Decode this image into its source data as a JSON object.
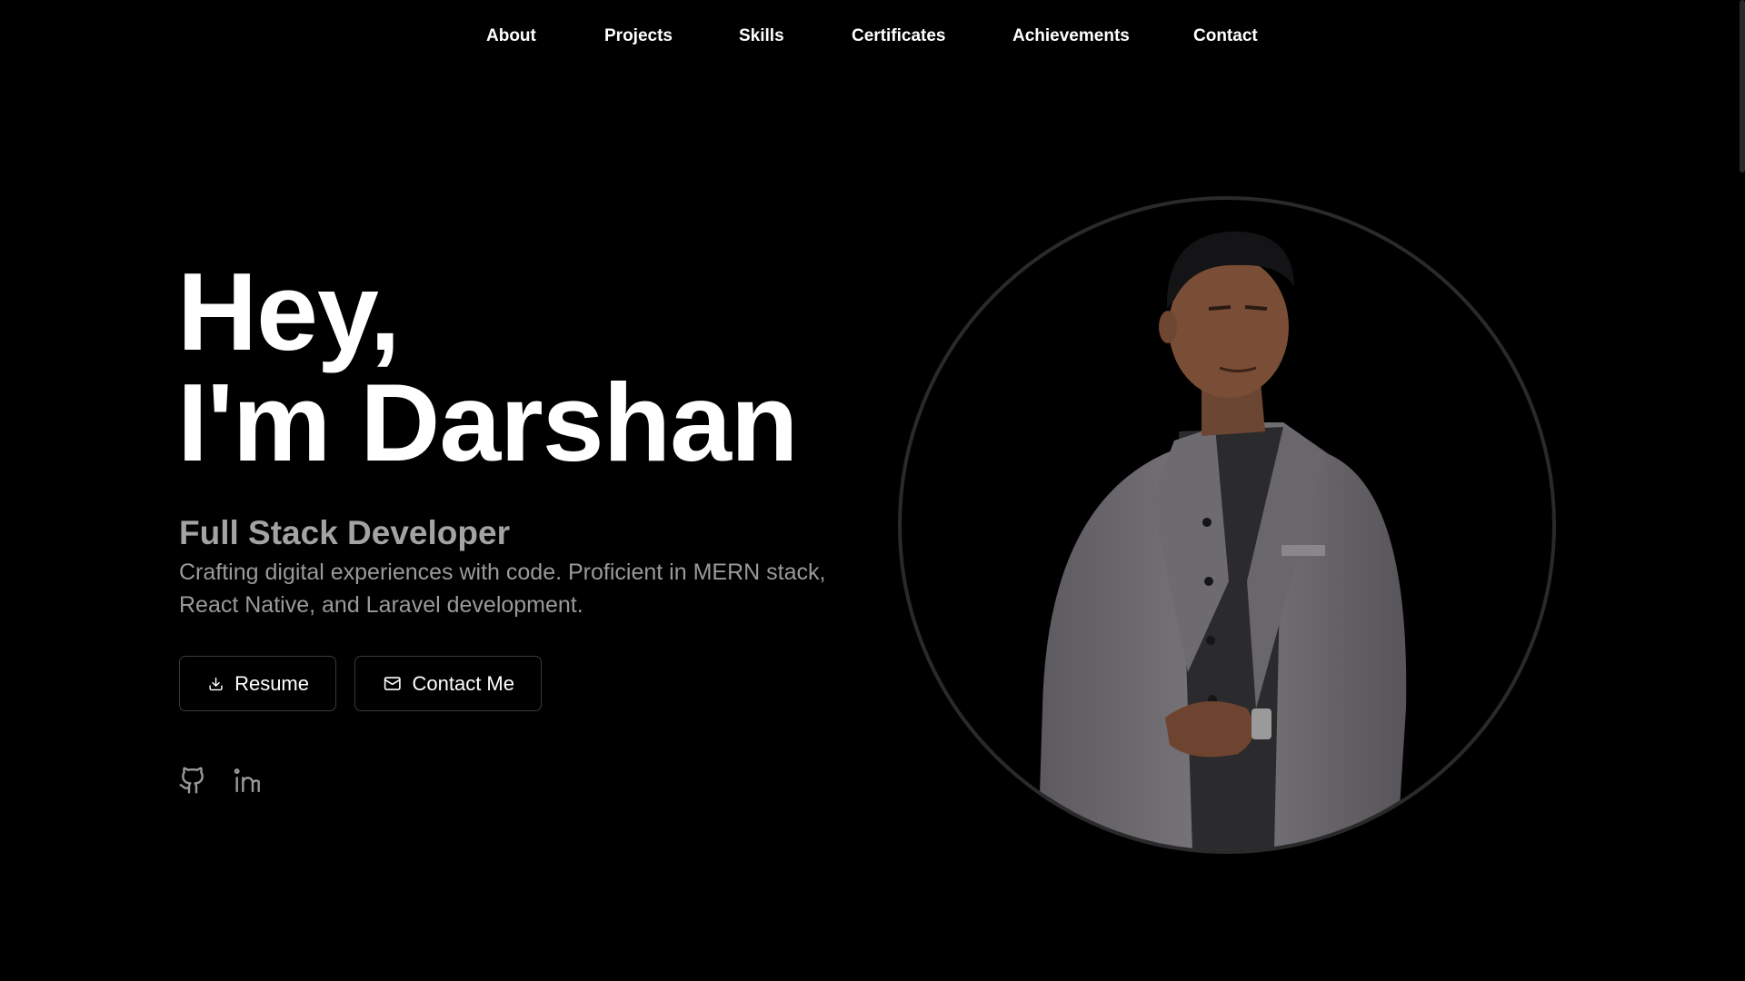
{
  "nav": {
    "items": [
      {
        "label": "About"
      },
      {
        "label": "Projects"
      },
      {
        "label": "Skills"
      },
      {
        "label": "Certificates"
      },
      {
        "label": "Achievements"
      },
      {
        "label": "Contact"
      }
    ]
  },
  "hero": {
    "greeting": "Hey,",
    "name_line": "I'm Darshan",
    "role": "Full Stack Developer",
    "description": "Crafting digital experiences with code. Proficient in MERN stack, React Native, and Laravel development."
  },
  "buttons": {
    "resume_label": "Resume",
    "resume_icon": "download-icon",
    "contact_label": "Contact Me",
    "contact_icon": "mail-icon"
  },
  "social": {
    "github_icon": "github-icon",
    "linkedin_icon": "linkedin-icon"
  },
  "colors": {
    "background": "#000000",
    "text": "#ffffff",
    "muted": "#a3a3a3",
    "border": "#3a3a3a",
    "ring": "#2a2a2a"
  }
}
